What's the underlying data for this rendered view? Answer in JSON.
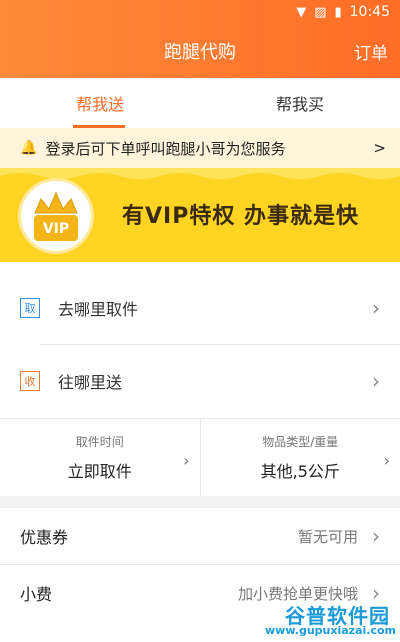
{
  "status_bar": {
    "time": "10:45",
    "icons": [
      "wifi-icon",
      "sim-off-icon",
      "battery-charging-icon"
    ]
  },
  "header": {
    "title": "跑腿代购",
    "action": "订单"
  },
  "tabs": [
    {
      "label": "帮我送",
      "active": true
    },
    {
      "label": "帮我买",
      "active": false
    }
  ],
  "notice": {
    "text": "登录后可下单呼叫跑腿小哥为您服务",
    "icon": "bell-icon",
    "arrow": ">"
  },
  "vip_banner": {
    "badge_text": "VIP",
    "slogan": "有VIP特权  办事就是快"
  },
  "pickup": {
    "tag": "取",
    "label": "去哪里取件"
  },
  "delivery": {
    "tag": "收",
    "label": "往哪里送"
  },
  "time_cell": {
    "caption": "取件时间",
    "value": "立即取件"
  },
  "goods_cell": {
    "caption": "物品类型/重量",
    "value": "其他,5公斤"
  },
  "coupon": {
    "label": "优惠券",
    "value": "暂无可用"
  },
  "tip": {
    "label": "小费",
    "value": "加小费抢单更快哦"
  },
  "watermark": {
    "title": "谷普软件园",
    "url": "www.gupuxiazai.com"
  },
  "colors": {
    "accent": "#ff6d27",
    "notice_bg": "#fff5dc",
    "vip_bg": "#ffd422",
    "tag_blue": "#3a8ee6",
    "tag_orange": "#f07a2f"
  }
}
